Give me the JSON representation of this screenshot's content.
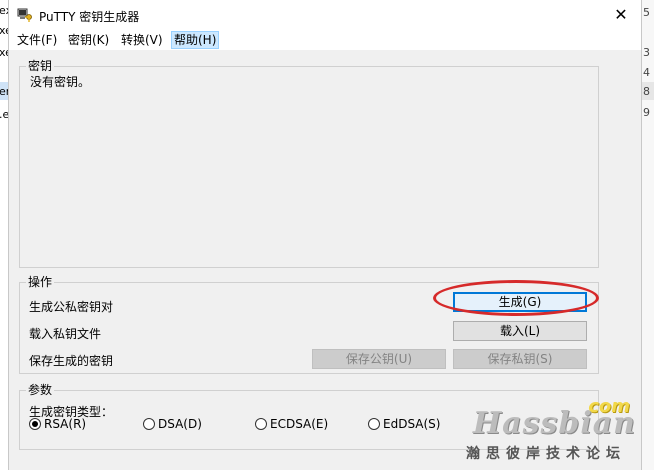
{
  "window": {
    "title": "PuTTY 密钥生成器",
    "close_glyph": "✕"
  },
  "menu": [
    {
      "label": "文件(F)"
    },
    {
      "label": "密钥(K)"
    },
    {
      "label": "转换(V)"
    },
    {
      "label": "帮助(H)"
    }
  ],
  "key_group": {
    "label": "密钥",
    "content": "没有密钥。"
  },
  "actions_group": {
    "label": "操作",
    "rows": [
      {
        "label": "生成公私密钥对"
      },
      {
        "label": "载入私钥文件"
      },
      {
        "label": "保存生成的密钥"
      }
    ],
    "generate_button": "生成(G)",
    "load_button": "载入(L)",
    "save_public_button": "保存公钥(U)",
    "save_private_button": "保存私钥(S)"
  },
  "params_group": {
    "label": "参数",
    "key_type_label": "生成密钥类型：",
    "types": [
      {
        "label": "RSA(R)",
        "checked": true
      },
      {
        "label": "DSA(D)",
        "checked": false
      },
      {
        "label": "ECDSA(E)",
        "checked": false
      },
      {
        "label": "EdDSA(S)",
        "checked": false
      }
    ]
  },
  "background": {
    "left_fragments": [
      "ex",
      "xe",
      "xe",
      "en",
      ".e"
    ],
    "right_digits": [
      "5",
      "3",
      "4",
      "8",
      "9"
    ]
  },
  "watermark": {
    "main": "Hassbian",
    "com": "com",
    "sub": "瀚思彼岸技术论坛"
  },
  "colors": {
    "accent_border": "#0078d7",
    "annotation_circle": "#d62a2a",
    "menu_active_bg": "#cce8ff"
  }
}
